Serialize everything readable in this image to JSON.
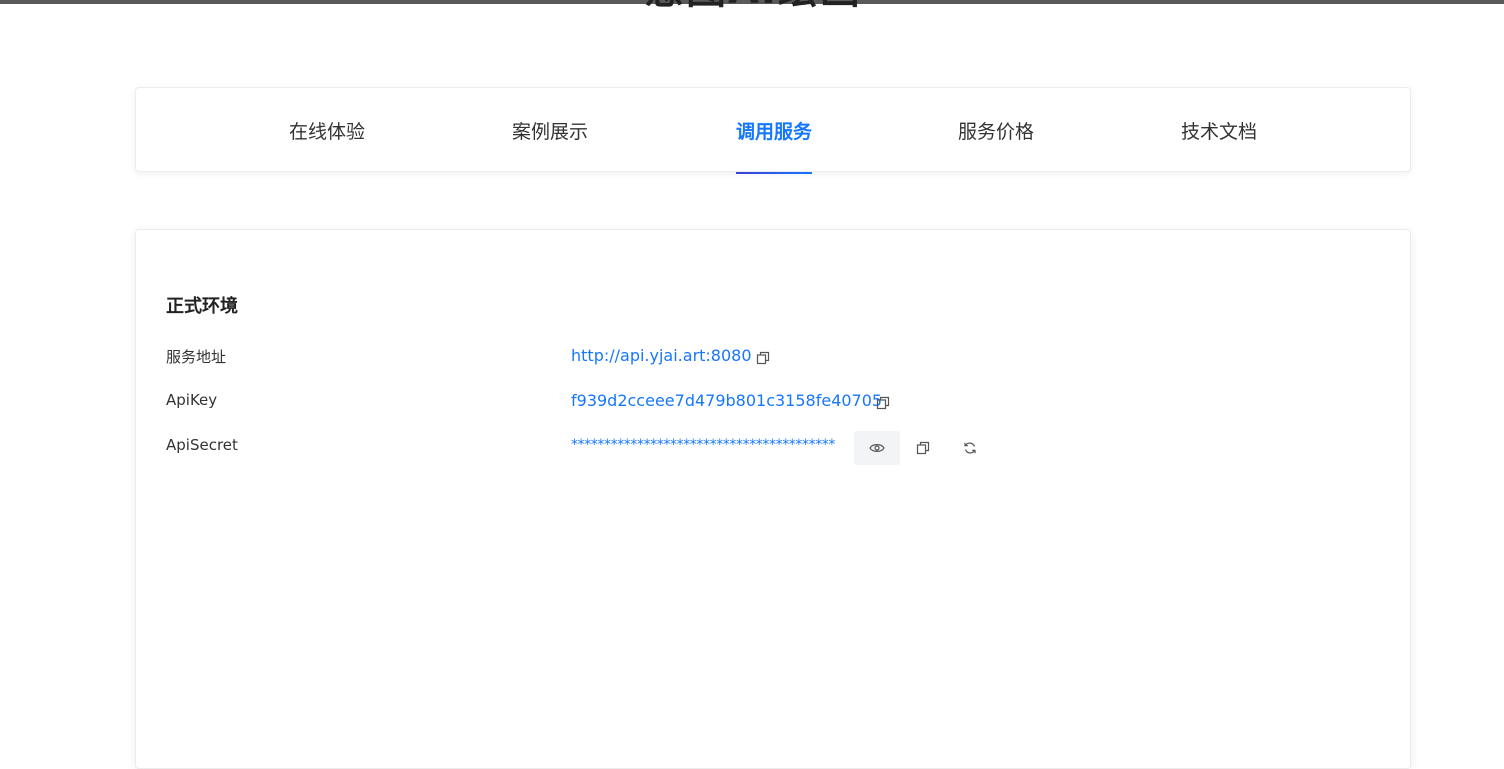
{
  "tabs": [
    {
      "label": "在线体验",
      "active": false
    },
    {
      "label": "案例展示",
      "active": false
    },
    {
      "label": "调用服务",
      "active": true
    },
    {
      "label": "服务价格",
      "active": false
    },
    {
      "label": "技术文档",
      "active": false
    }
  ],
  "section": {
    "title": "正式环境",
    "rows": [
      {
        "label": "服务地址",
        "value": "http://api.yjai.art:8080"
      },
      {
        "label": "ApiKey",
        "value": "f939d2cceee7d479b801c3158fe40705"
      },
      {
        "label": "ApiSecret",
        "value": "****************************************"
      }
    ]
  },
  "icons": {
    "copy": "copy-icon",
    "eye": "eye-icon",
    "refresh": "refresh-icon"
  },
  "colors": {
    "accent": "#1677ff",
    "text": "#333333"
  }
}
